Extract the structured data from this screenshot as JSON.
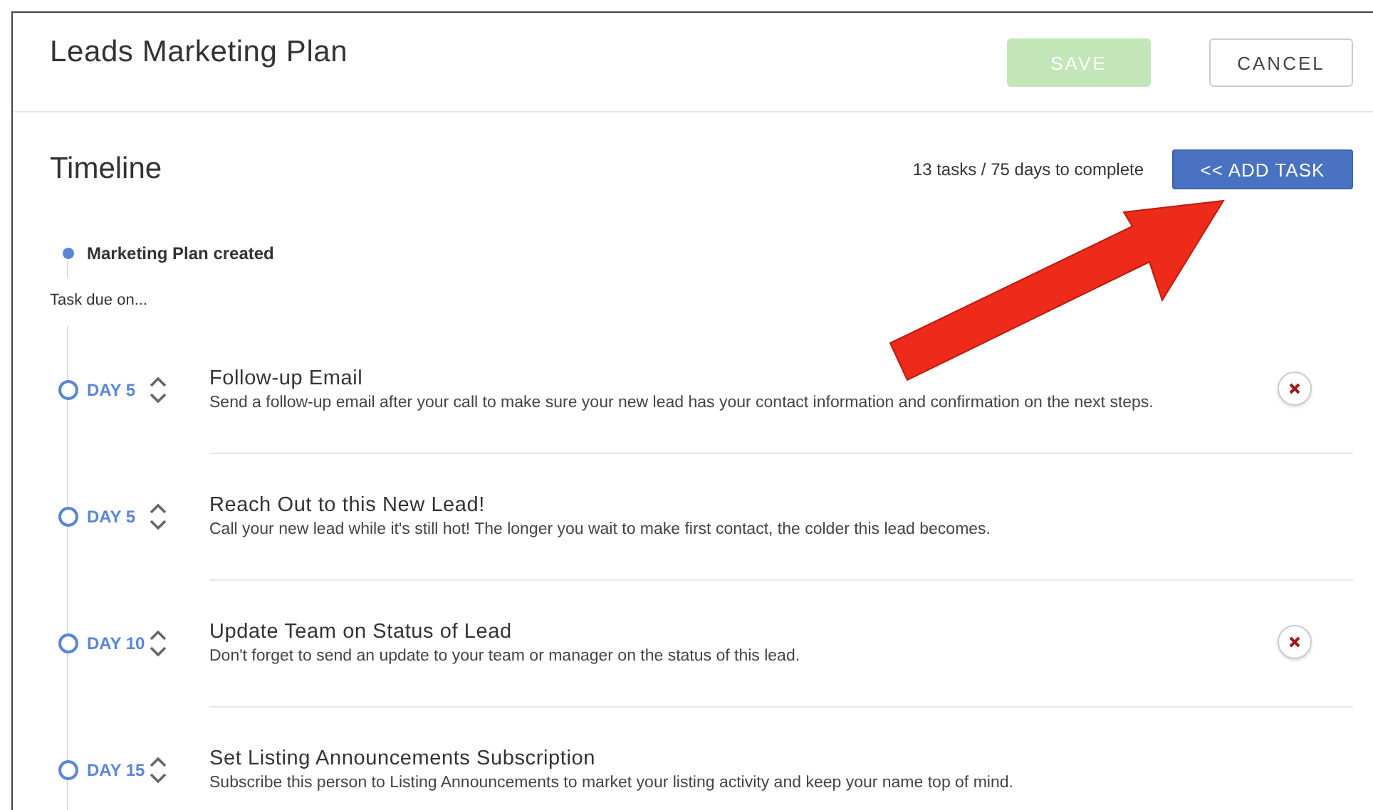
{
  "header": {
    "title": "Leads Marketing Plan",
    "buttons": [
      {
        "label": "SAVE",
        "kind": "primary",
        "disabled": true
      },
      {
        "label": "CANCEL",
        "kind": "secondary"
      }
    ]
  },
  "timeline": {
    "title": "Timeline",
    "summary": "13 tasks / 75 days to complete",
    "add_button": "<< ADD TASK",
    "start_event": "Marketing Plan created",
    "due_label": "Task due on...",
    "tasks": [
      {
        "day": "DAY 5",
        "title": "Follow-up Email",
        "description": "Send a follow-up email after your call to make sure your new lead has your contact information and confirmation on the next steps.",
        "removable": true
      },
      {
        "day": "DAY 5",
        "title": "Reach Out to this New Lead!",
        "description": "Call your new lead while it's still hot! The longer you wait to make first contact, the colder this lead becomes.",
        "removable": false
      },
      {
        "day": "DAY 10",
        "title": "Update Team on Status of Lead",
        "description": "Don't forget to send an update to your team or manager on the status of this lead.",
        "removable": true
      },
      {
        "day": "DAY 15",
        "title": "Set Listing Announcements Subscription",
        "description": "Subscribe this person to Listing Announcements to market your listing activity and keep your name top of mind.",
        "removable": false
      }
    ]
  }
}
